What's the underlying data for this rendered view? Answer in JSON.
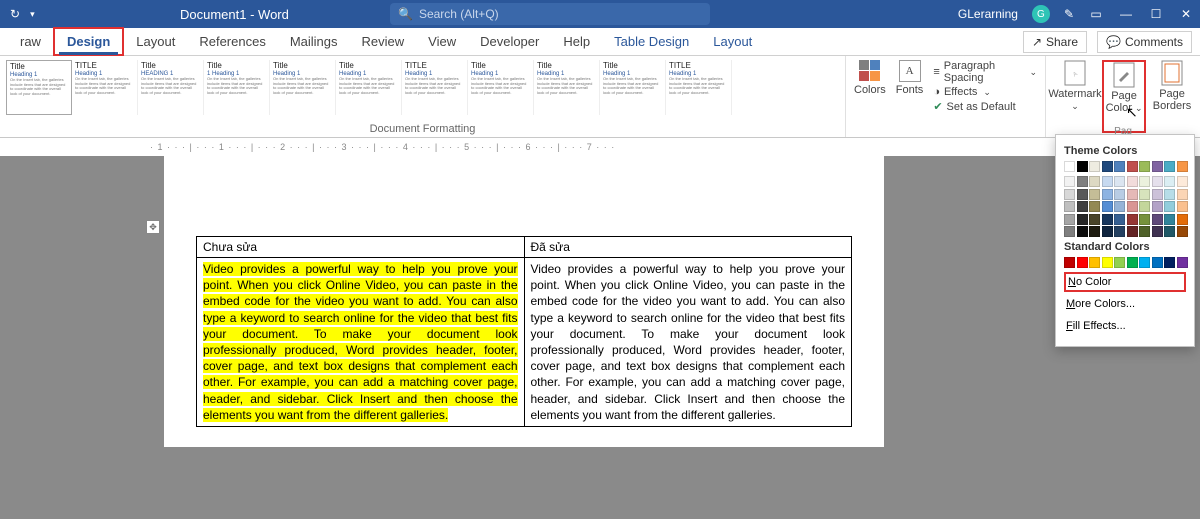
{
  "titlebar": {
    "doc_title": "Document1 - Word",
    "search_placeholder": "Search (Alt+Q)",
    "user_name": "GLerarning",
    "user_initial": "G"
  },
  "tabs": {
    "items": [
      "raw",
      "Design",
      "Layout",
      "References",
      "Mailings",
      "Review",
      "View",
      "Developer",
      "Help",
      "Table Design",
      "Layout"
    ],
    "active_index": 1,
    "share": "Share",
    "comments": "Comments"
  },
  "ribbon": {
    "doc_format_label": "Document Formatting",
    "themes": [
      {
        "title": "Title",
        "heading": "Heading 1"
      },
      {
        "title": "TITLE",
        "heading": "Heading 1"
      },
      {
        "title": "Title",
        "heading": "HEADING 1"
      },
      {
        "title": "Title",
        "heading": "1 Heading 1"
      },
      {
        "title": "Title",
        "heading": "Heading 1"
      },
      {
        "title": "Title",
        "heading": "Heading 1"
      },
      {
        "title": "TITLE",
        "heading": "Heading 1"
      },
      {
        "title": "Title",
        "heading": "Heading 1"
      },
      {
        "title": "Title",
        "heading": "Heading 1"
      },
      {
        "title": "Title",
        "heading": "Heading 1"
      },
      {
        "title": "TITLE",
        "heading": "Heading 1"
      }
    ],
    "colors_label": "Colors",
    "fonts_label": "Fonts",
    "paragraph_spacing": "Paragraph Spacing",
    "effects": "Effects",
    "set_default": "Set as Default",
    "watermark": "Watermark",
    "page_color": "Page Color",
    "page_borders": "Page Borders",
    "page_bg_group": "Pag"
  },
  "ruler_text": "· 1 · · · | · · · 1 · · · | · · · 2 · · · | · · · 3 · · · | · · · 4 · · · | · · · 5 · · · | · · · 6 · · · | · · · 7 · · ·",
  "table": {
    "left_header": "Chưa sửa",
    "right_header": "Đã sửa",
    "left_body": "Video provides a powerful way to help you prove your point. When you click Online Video, you can paste in the embed code for the video you want to add. You can also type a keyword to search online for the video that best fits your document. To make your document look professionally produced, Word provides header, footer, cover page, and text box designs that complement each other. For example, you can add a matching cover page, header, and sidebar. Click Insert and then choose the elements you want from the different galleries.",
    "right_body": "Video provides a powerful way to help you prove your point. When you click Online Video, you can paste in the embed code for the video you want to add. You can also type a keyword to search online for the video that best fits your document. To make your document look professionally produced, Word provides header, footer, cover page, and text box designs that complement each other. For example, you can add a matching cover page, header, and sidebar. Click Insert and then choose the elements you want from the different galleries."
  },
  "popup": {
    "theme_colors_label": "Theme Colors",
    "theme_row1": [
      "#ffffff",
      "#000000",
      "#eeece1",
      "#1f497d",
      "#4f81bd",
      "#c0504d",
      "#9bbb59",
      "#8064a2",
      "#4bacc6",
      "#f79646"
    ],
    "theme_shades": [
      [
        "#f2f2f2",
        "#7f7f7f",
        "#ddd9c3",
        "#c6d9f0",
        "#dbe5f1",
        "#f2dcdb",
        "#ebf1dd",
        "#e5e0ec",
        "#dbeef3",
        "#fdeada"
      ],
      [
        "#d8d8d8",
        "#595959",
        "#c4bd97",
        "#8db3e2",
        "#b8cce4",
        "#e5b9b7",
        "#d7e3bc",
        "#ccc1d9",
        "#b7dde8",
        "#fbd5b5"
      ],
      [
        "#bfbfbf",
        "#3f3f3f",
        "#938953",
        "#548dd4",
        "#95b3d7",
        "#d99694",
        "#c3d69b",
        "#b2a2c7",
        "#92cddc",
        "#fac08f"
      ],
      [
        "#a5a5a5",
        "#262626",
        "#494429",
        "#17365d",
        "#366092",
        "#953734",
        "#76923c",
        "#5f497a",
        "#31859b",
        "#e36c09"
      ],
      [
        "#7f7f7f",
        "#0c0c0c",
        "#1d1b10",
        "#0f243e",
        "#244061",
        "#632423",
        "#4f6128",
        "#3f3151",
        "#205867",
        "#974806"
      ]
    ],
    "standard_colors_label": "Standard Colors",
    "standard_row": [
      "#c00000",
      "#ff0000",
      "#ffc000",
      "#ffff00",
      "#92d050",
      "#00b050",
      "#00b0f0",
      "#0070c0",
      "#002060",
      "#7030a0"
    ],
    "no_color": "No Color",
    "more_colors": "More Colors...",
    "fill_effects": "Fill Effects..."
  }
}
